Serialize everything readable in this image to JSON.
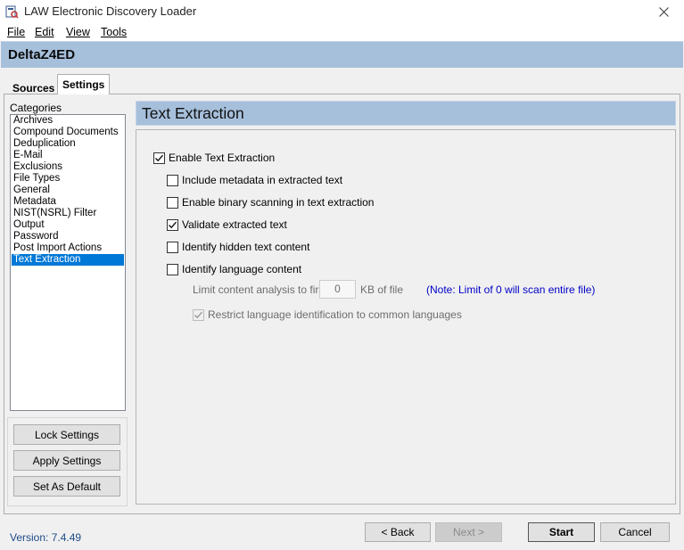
{
  "window": {
    "title": "LAW Electronic Discovery Loader",
    "close_glyph": "✕"
  },
  "menu": {
    "file": "File",
    "edit": "Edit",
    "view": "View",
    "tools": "Tools"
  },
  "project": {
    "name": "DeltaZ4ED"
  },
  "tabs": [
    {
      "label": "Sources",
      "selected": false
    },
    {
      "label": "Settings",
      "selected": true
    }
  ],
  "categories": {
    "label": "Categories",
    "items": [
      "Archives",
      "Compound Documents",
      "Deduplication",
      "E-Mail",
      "Exclusions",
      "File Types",
      "General",
      "Metadata",
      "NIST(NSRL) Filter",
      "Output",
      "Password",
      "Post Import Actions",
      "Text Extraction"
    ],
    "selected": "Text Extraction"
  },
  "side_buttons": {
    "lock": "Lock Settings",
    "apply": "Apply Settings",
    "default": "Set As Default"
  },
  "section": {
    "title": "Text Extraction",
    "options": [
      {
        "label": "Enable Text Extraction",
        "checked": true,
        "enabled": true
      },
      {
        "label": "Include metadata in extracted text",
        "checked": false,
        "enabled": true
      },
      {
        "label": "Enable binary scanning in text extraction",
        "checked": false,
        "enabled": true
      },
      {
        "label": "Validate extracted text",
        "checked": true,
        "enabled": true
      },
      {
        "label": "Identify hidden text content",
        "checked": false,
        "enabled": true
      },
      {
        "label": "Identify language content",
        "checked": false,
        "enabled": true
      }
    ],
    "limit": {
      "prefix": "Limit content analysis to first",
      "value": "0",
      "suffix": "KB of file",
      "note": "(Note: Limit of 0 will scan entire file)"
    },
    "restrict": {
      "label": "Restrict language identification to common languages",
      "checked": true,
      "enabled": false
    }
  },
  "footer": {
    "version": "Version: 7.4.49",
    "back": "< Back",
    "next": "Next >",
    "start": "Start",
    "cancel": "Cancel"
  },
  "colors": {
    "header_band": "#a6bfdb",
    "selection": "#0078d7",
    "note": "#0000c8"
  }
}
